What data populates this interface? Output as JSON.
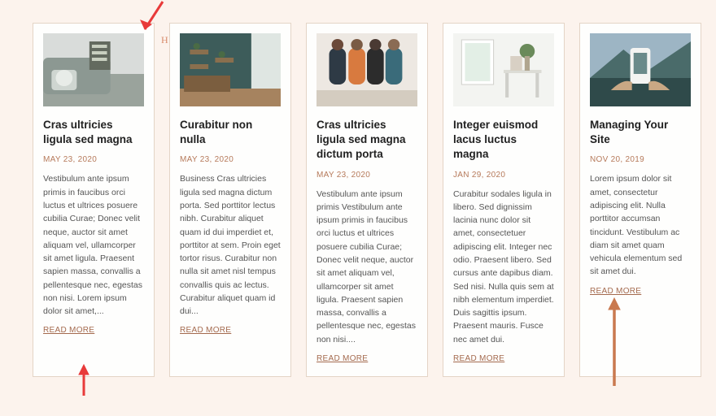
{
  "read_more_label": "READ MORE",
  "cards": [
    {
      "title": "Cras ultricies ligula sed magna",
      "date": "MAY 23, 2020",
      "excerpt": "Vestibulum ante ipsum primis in faucibus orci luctus et ultrices posuere cubilia Curae; Donec velit neque, auctor sit amet aliquam vel, ullamcorper sit amet ligula. Praesent sapien massa, convallis a pellentesque nec, egestas non nisi. Lorem ipsum dolor sit amet,..."
    },
    {
      "title": "Curabitur non nulla",
      "date": "MAY 23, 2020",
      "excerpt": "Business Cras ultricies ligula sed magna dictum porta. Sed porttitor lectus nibh. Curabitur aliquet quam id dui imperdiet et, porttitor at sem. Proin eget tortor risus. Curabitur non nulla sit amet nisl tempus convallis quis ac lectus. Curabitur aliquet quam id dui..."
    },
    {
      "title": "Cras ultricies ligula sed magna dictum porta",
      "date": "MAY 23, 2020",
      "excerpt": "Vestibulum ante ipsum primis Vestibulum ante ipsum primis in faucibus orci luctus et ultrices posuere cubilia Curae; Donec velit neque, auctor sit amet aliquam vel, ullamcorper sit amet ligula. Praesent sapien massa, convallis a pellentesque nec, egestas non nisi...."
    },
    {
      "title": "Integer euismod lacus luctus magna",
      "date": "JAN 29, 2020",
      "excerpt": "Curabitur sodales ligula in libero. Sed dignissim lacinia nunc dolor sit amet, consectetuer adipiscing elit. Integer nec odio. Praesent libero. Sed cursus ante dapibus diam. Sed nisi. Nulla quis sem at nibh elementum imperdiet. Duis sagittis ipsum. Praesent mauris. Fusce nec amet dui."
    },
    {
      "title": "Managing Your Site",
      "date": "NOV 20, 2019",
      "excerpt": "Lorem ipsum dolor sit amet, consectetur adipiscing elit. Nulla porttitor accumsan tincidunt. Vestibulum ac diam sit amet quam vehicula elementum sed sit amet dui."
    }
  ]
}
